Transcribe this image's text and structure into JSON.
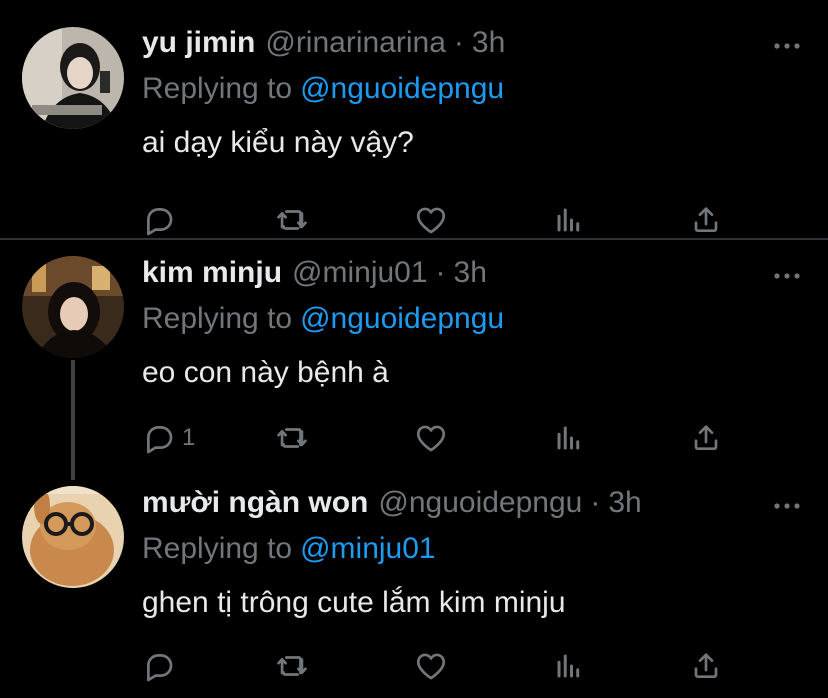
{
  "tweets": [
    {
      "name": "yu jimin",
      "handle": "@rinarinarina",
      "separator": "·",
      "time": "3h",
      "replying_prefix": "Replying to",
      "replying_to": "@nguoidepngu",
      "text": "ai dạy kiểu này vậy?",
      "reply_count": ""
    },
    {
      "name": "kim minju",
      "handle": "@minju01",
      "separator": "·",
      "time": "3h",
      "replying_prefix": "Replying to",
      "replying_to": "@nguoidepngu",
      "text": "eo con này bệnh à",
      "reply_count": "1"
    },
    {
      "name": "mười ngàn won",
      "handle": "@nguoidepngu",
      "separator": "·",
      "time": "3h",
      "replying_prefix": "Replying to",
      "replying_to": "@minju01",
      "text": "ghen tị trông cute lắm kim minju",
      "reply_count": ""
    }
  ],
  "icons": {
    "reply": "reply-icon",
    "retweet": "retweet-icon",
    "like": "heart-icon",
    "views": "analytics-icon",
    "share": "share-icon",
    "more": "more-icon"
  },
  "colors": {
    "background": "#000000",
    "text": "#e7e9ea",
    "secondary": "#71767b",
    "link": "#1d9bf0",
    "divider": "#2f3336"
  }
}
